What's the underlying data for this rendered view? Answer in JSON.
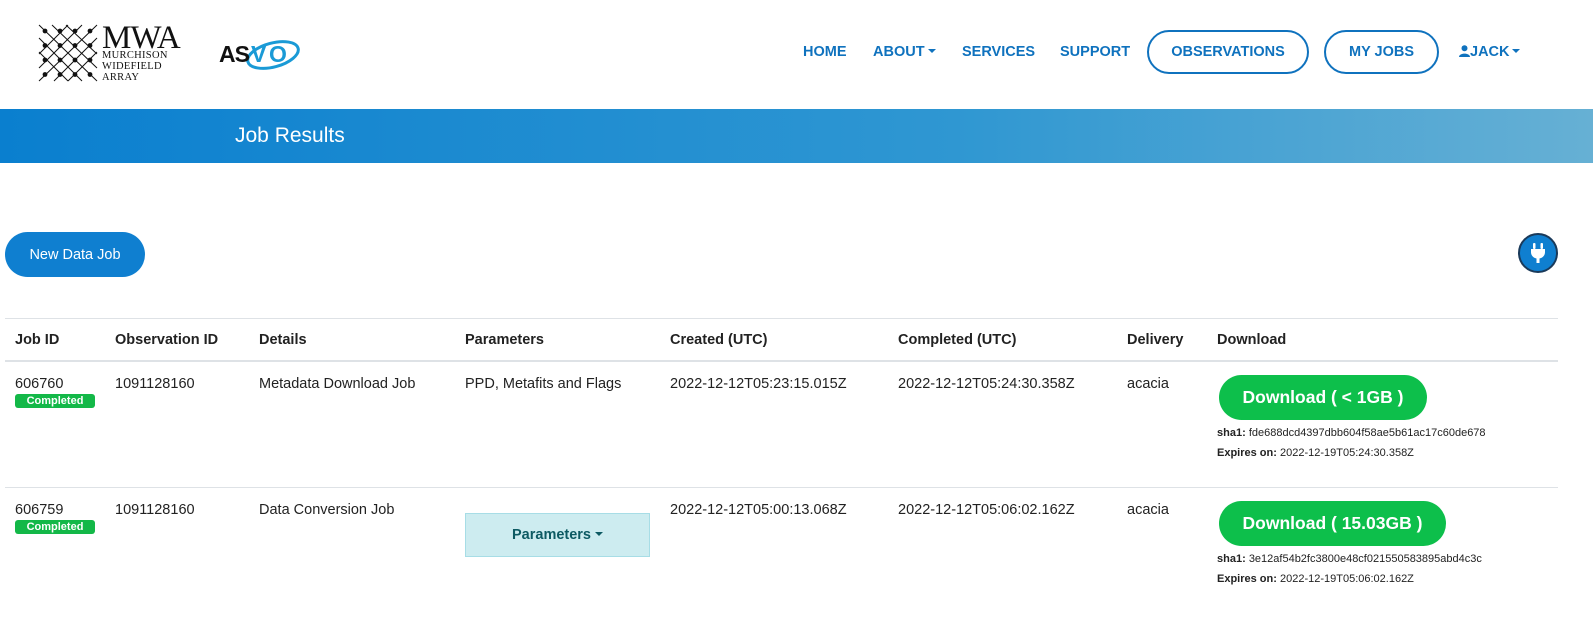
{
  "brand": {
    "mwa_title": "MWA",
    "mwa_line1": "MURCHISON",
    "mwa_line2": "WIDEFIELD",
    "mwa_line3": "ARRAY",
    "asvo": "ASVO"
  },
  "nav": {
    "home": "HOME",
    "about": "ABOUT",
    "services": "SERVICES",
    "support": "SUPPORT",
    "observations": "OBSERVATIONS",
    "my_jobs": "MY JOBS",
    "user": "JACK"
  },
  "banner": {
    "title": "Job Results"
  },
  "actions": {
    "new_job": "New Data Job"
  },
  "colors": {
    "primary": "#0f72be",
    "success": "#0dbf4b",
    "banner_start": "#0a7fcf",
    "banner_end": "#66b0d4"
  },
  "table": {
    "headers": {
      "job_id": "Job ID",
      "obs_id": "Observation ID",
      "details": "Details",
      "parameters": "Parameters",
      "created": "Created (UTC)",
      "completed": "Completed (UTC)",
      "delivery": "Delivery",
      "download": "Download"
    },
    "rows": [
      {
        "job_id": "606760",
        "status": "Completed",
        "obs_id": "1091128160",
        "details": "Metadata Download Job",
        "parameters": "PPD, Metafits and Flags",
        "created": "2022-12-12T05:23:15.015Z",
        "completed": "2022-12-12T05:24:30.358Z",
        "delivery": "acacia",
        "download_label": "Download ( < 1GB )",
        "sha1_label": "sha1:",
        "sha1": "fde688dcd4397dbb604f58ae5b61ac17c60de678",
        "expires_label": "Expires on:",
        "expires": "2022-12-19T05:24:30.358Z"
      },
      {
        "job_id": "606759",
        "status": "Completed",
        "obs_id": "1091128160",
        "details": "Data Conversion Job",
        "parameters_button": "Parameters",
        "created": "2022-12-12T05:00:13.068Z",
        "completed": "2022-12-12T05:06:02.162Z",
        "delivery": "acacia",
        "download_label": "Download ( 15.03GB )",
        "sha1_label": "sha1:",
        "sha1": "3e12af54b2fc3800e48cf021550583895abd4c3c",
        "expires_label": "Expires on:",
        "expires": "2022-12-19T05:06:02.162Z"
      }
    ]
  }
}
